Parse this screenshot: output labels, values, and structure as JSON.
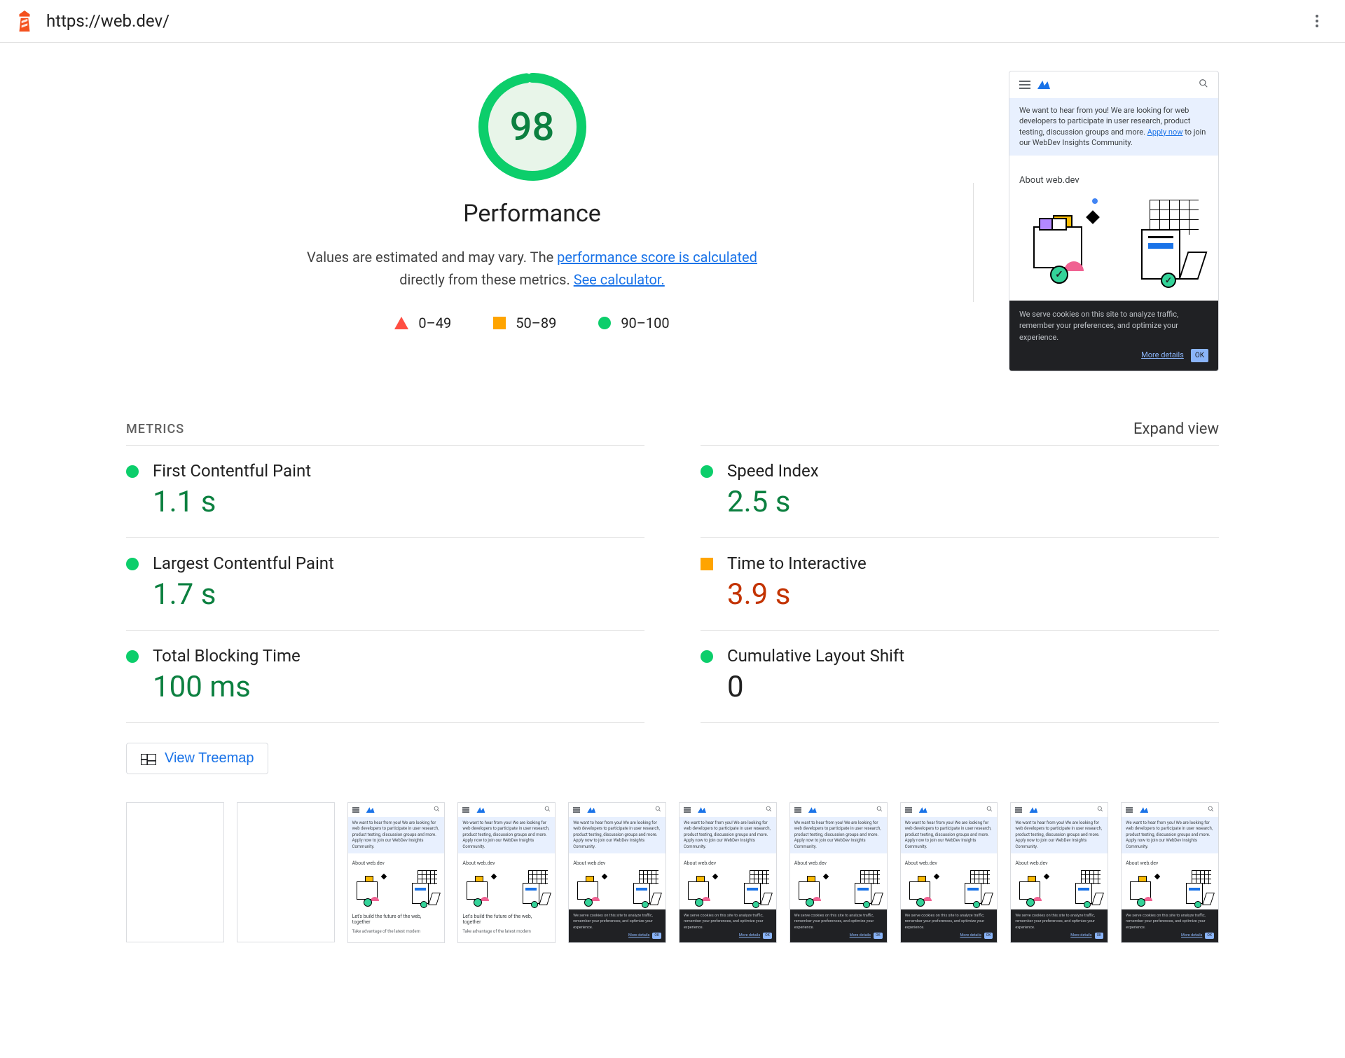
{
  "url": "https://web.dev/",
  "score": {
    "value": "98",
    "label": "Performance",
    "percent": 98
  },
  "desc": {
    "part1": "Values are estimated and may vary. The ",
    "link1": "performance score is calculated",
    "part2": " directly from these metrics. ",
    "link2": "See calculator."
  },
  "legend": {
    "fail": "0–49",
    "avg": "50–89",
    "pass": "90–100"
  },
  "preview": {
    "banner_prefix": "We want to hear from you! We are looking for web developers to participate in user research, product testing, discussion groups and more. ",
    "banner_link": "Apply now",
    "banner_suffix": " to join our WebDev Insights Community.",
    "about": "About web.dev",
    "cookie": "We serve cookies on this site to analyze traffic, remember your preferences, and optimize your experience.",
    "more": "More details",
    "ok": "OK"
  },
  "metrics_header": {
    "title": "METRICS",
    "expand": "Expand view"
  },
  "metrics": [
    {
      "label": "First Contentful Paint",
      "value": "1.1 s",
      "status": "green"
    },
    {
      "label": "Speed Index",
      "value": "2.5 s",
      "status": "green"
    },
    {
      "label": "Largest Contentful Paint",
      "value": "1.7 s",
      "status": "green"
    },
    {
      "label": "Time to Interactive",
      "value": "3.9 s",
      "status": "orange"
    },
    {
      "label": "Total Blocking Time",
      "value": "100 ms",
      "status": "green"
    },
    {
      "label": "Cumulative Layout Shift",
      "value": "0",
      "status": "green",
      "valcolor": "black"
    }
  ],
  "treemap_label": "View Treemap",
  "thumb": {
    "banner_short": "We want to hear from you! We are looking for web developers to participate in user research, product testing, discussion groups and more. Apply now to join our WebDev Insights Community.",
    "about": "About web.dev",
    "foot_title": "Let's build the future of the web, together",
    "foot_sub": "Take advantage of the latest modern",
    "cookie_short": "We serve cookies on this site to analyze traffic, remember your preferences, and optimize your experience."
  },
  "filmstrip_variants": [
    "blank",
    "blank",
    "light",
    "light",
    "dark",
    "dark",
    "dark",
    "dark",
    "dark",
    "dark"
  ]
}
